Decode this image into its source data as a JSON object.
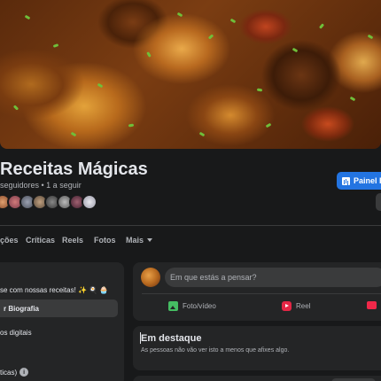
{
  "cover": {
    "alt": ""
  },
  "page": {
    "name": "Receitas Mágicas",
    "stats": "seguidores • 1 a seguir"
  },
  "header": {
    "dashboard_label": "Painel Pr"
  },
  "tabs": [
    {
      "label": "ções"
    },
    {
      "label": "Críticas"
    },
    {
      "label": "Reels"
    },
    {
      "label": "Fotos"
    },
    {
      "label": "Mais"
    }
  ],
  "intro": {
    "bio_text": "se com nossas receitas! ✨ 🍳 🧁",
    "bio_button": "r Biografia",
    "line1": "os digitais",
    "line2": "ticas)",
    "info_glyph": "i"
  },
  "composer": {
    "placeholder": "Em que estás a pensar?",
    "actions": [
      {
        "label": "Foto/vídeo",
        "icon": "photo-icon"
      },
      {
        "label": "Reel",
        "icon": "reel-icon"
      },
      {
        "label": "",
        "icon": "live-video-icon"
      }
    ]
  },
  "featured": {
    "title": "Em destaque",
    "subtitle": "As pessoas não vão ver isto a menos que afixes algo."
  },
  "colors": {
    "accent": "#2374e1",
    "background": "#18191a",
    "card": "#242526"
  }
}
